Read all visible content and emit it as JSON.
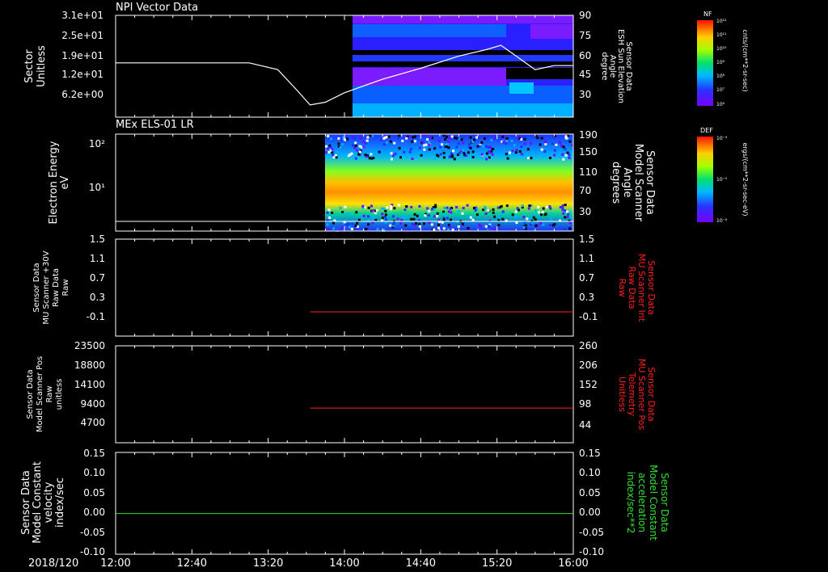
{
  "chart_data": [
    {
      "type": "heatmap",
      "title": "NPI Vector Data",
      "ylabel": [
        "Sector",
        "Unitless"
      ],
      "yticks": [
        "3.1e+01",
        "2.5e+01",
        "1.9e+01",
        "1.2e+01",
        "6.2e+00"
      ],
      "right_ylabel": [
        "Sensor Data",
        "ESH Sun Elevation",
        "Angle",
        "degree"
      ],
      "right_yticks": [
        "90",
        "75",
        "60",
        "45",
        "30"
      ],
      "right_ylim": [
        15,
        90
      ],
      "data_start_time": "14:04",
      "overlay_line": {
        "name": "ESH Sun Elevation",
        "color": "#ffffff",
        "x": [
          "12:00",
          "13:10",
          "13:25",
          "13:35",
          "13:42",
          "13:50",
          "14:00",
          "14:20",
          "14:40",
          "15:00",
          "15:15",
          "15:22",
          "15:30",
          "15:40",
          "15:50",
          "16:00"
        ],
        "y": [
          55,
          55,
          50,
          35,
          24,
          26,
          33,
          43,
          51,
          60,
          65,
          68,
          60,
          50,
          53,
          53
        ]
      },
      "colorbar": {
        "label": "NF",
        "units": "cnts/(cm**2-sr-sec)",
        "ticks": [
          "10¹²",
          "10¹¹",
          "10¹⁰",
          "10⁹",
          "10⁸",
          "10⁷",
          "10⁶"
        ]
      }
    },
    {
      "type": "heatmap",
      "title": "MEx ELS-01 LR",
      "ylabel": [
        "Electron Energy",
        "eV"
      ],
      "yticks": [
        "10²",
        "10¹"
      ],
      "right_ylabel": [
        "Sensor Data",
        "Model Scanner",
        "Angle",
        "degrees"
      ],
      "right_yticks": [
        "190",
        "150",
        "110",
        "70",
        "30"
      ],
      "right_ylim": [
        0,
        190
      ],
      "data_start_time": "13:50",
      "overlay_line": {
        "name": "Scanner Angle",
        "color": "#ffffff",
        "x": [
          "12:00",
          "16:00"
        ],
        "y": [
          8,
          8
        ]
      },
      "colorbar": {
        "label": "DEF",
        "units": "ergs/(cm**2-sr-sec-eV)",
        "ticks": [
          "10⁻⁴",
          "10⁻⁵",
          "10⁻⁶"
        ]
      }
    },
    {
      "type": "line",
      "ylabel": [
        "Sensor Data",
        "MU Scanner +30V",
        "Raw Data",
        "Raw"
      ],
      "yticks": [
        "1.5",
        "1.1",
        "0.7",
        "0.3",
        "-0.1"
      ],
      "ylim": [
        -0.5,
        1.5
      ],
      "right_ylabel": [
        "Sensor Data",
        "MU Scanner Int",
        "Raw Data",
        "Raw"
      ],
      "right_yticks": [
        "1.5",
        "1.1",
        "0.7",
        "0.3",
        "-0.1"
      ],
      "series": [
        {
          "color": "#ff2020",
          "x": [
            "13:42",
            "16:00"
          ],
          "y": [
            0.0,
            0.0
          ]
        }
      ]
    },
    {
      "type": "line",
      "ylabel": [
        "Sensor Data",
        "Model Scanner Pos",
        "Raw",
        "unitless"
      ],
      "yticks": [
        "23500",
        "18800",
        "14100",
        "9400",
        "4700"
      ],
      "ylim": [
        0,
        23500
      ],
      "right_ylabel": [
        "Sensor Data",
        "MU Scanner Pos",
        "Telemetry",
        "Unitless"
      ],
      "right_yticks": [
        "260",
        "206",
        "152",
        "98",
        "44"
      ],
      "series": [
        {
          "color": "#ff2020",
          "x": [
            "13:42",
            "16:00"
          ],
          "y": [
            8400,
            8400
          ]
        }
      ]
    },
    {
      "type": "line",
      "ylabel": [
        "Sensor Data",
        "Model Constant",
        "velocity",
        "index/sec"
      ],
      "yticks": [
        "0.15",
        "0.10",
        "0.05",
        "0.00",
        "-0.05",
        "-0.10"
      ],
      "ylim": [
        -0.1,
        0.15
      ],
      "right_ylabel": [
        "Sensor Data",
        "Model Constant",
        "acceleration",
        "index/sec**2"
      ],
      "right_yticks": [
        "0.15",
        "0.10",
        "0.05",
        "0.00",
        "-0.05",
        "-0.10"
      ],
      "series": [
        {
          "color": "#30e030",
          "x": [
            "12:00",
            "16:00"
          ],
          "y": [
            0.0,
            0.0
          ]
        }
      ]
    }
  ],
  "x_axis": {
    "date_label": "2018/120",
    "ticks": [
      "12:00",
      "12:40",
      "13:20",
      "14:00",
      "14:40",
      "15:20",
      "16:00"
    ],
    "range": [
      "12:00",
      "16:00"
    ]
  },
  "colors": {
    "background": "#000000",
    "axis": "#ffffff",
    "red_label": "#ff2020",
    "green_label": "#30e030"
  }
}
